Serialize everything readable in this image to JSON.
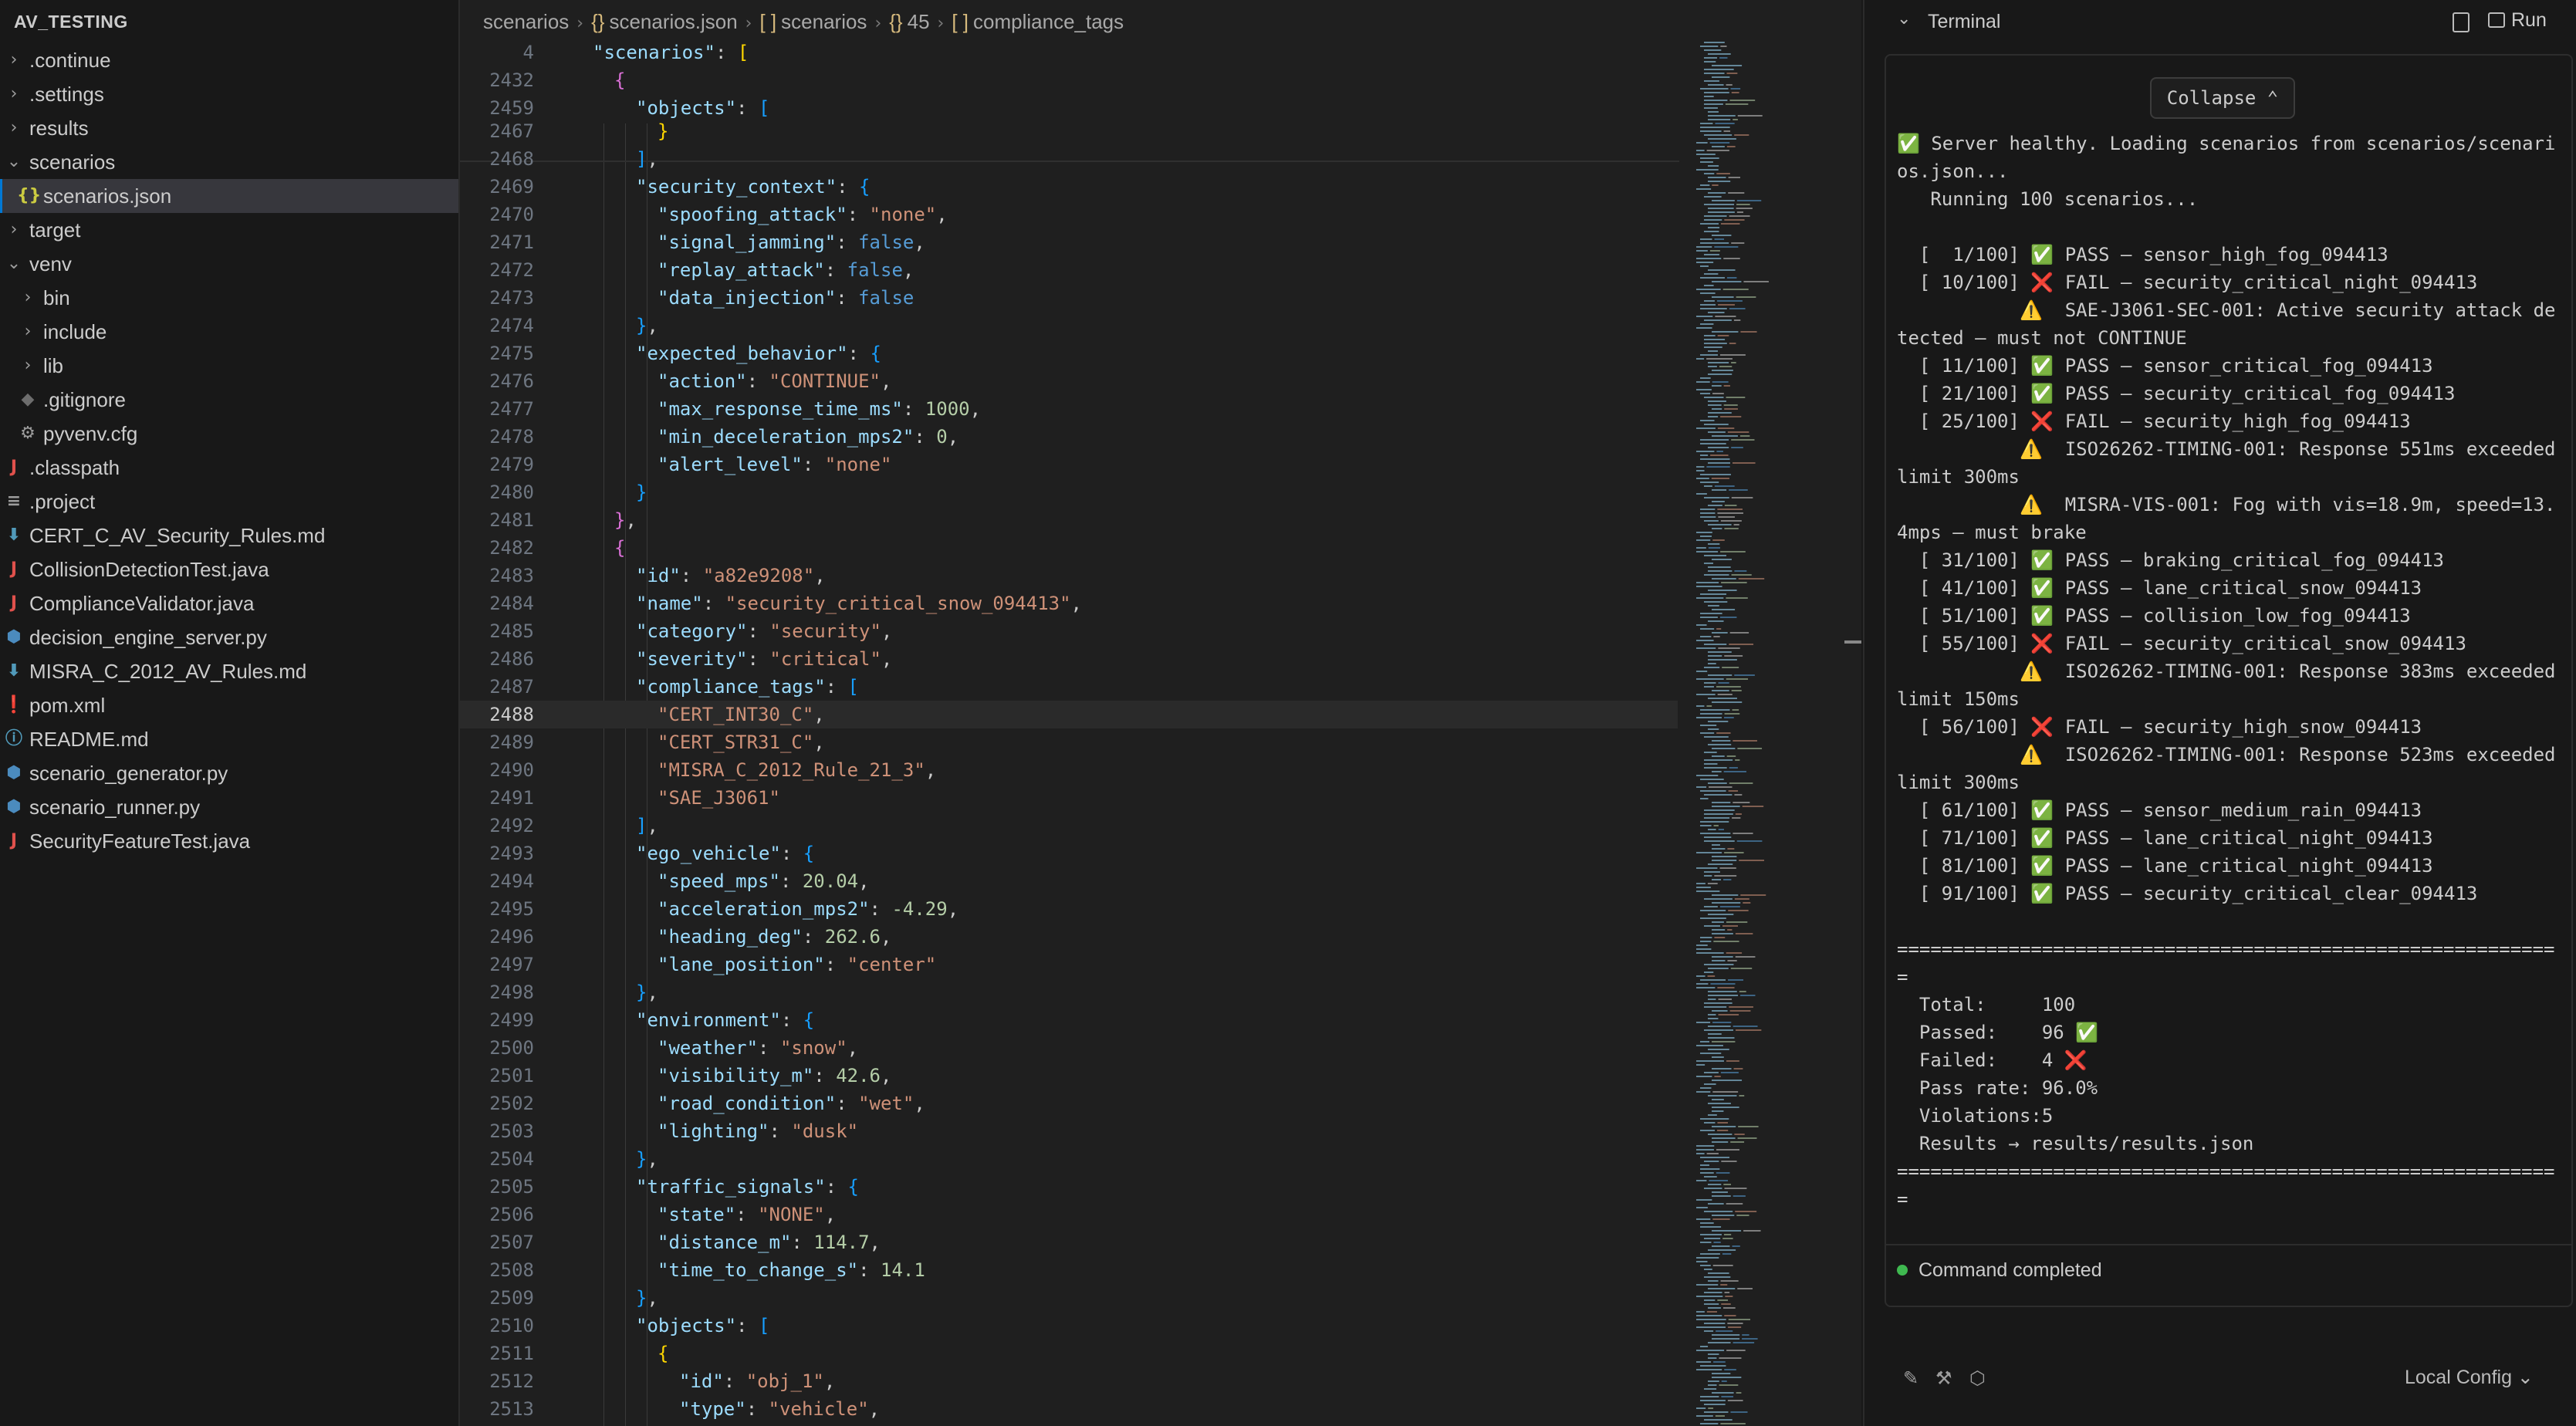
{
  "sidebar": {
    "title": "AV_TESTING",
    "items": [
      {
        "label": ".continue",
        "kind": "folder",
        "expanded": false,
        "depth": 0
      },
      {
        "label": ".settings",
        "kind": "folder",
        "expanded": false,
        "depth": 0
      },
      {
        "label": "results",
        "kind": "folder",
        "expanded": false,
        "depth": 0
      },
      {
        "label": "scenarios",
        "kind": "folder",
        "expanded": true,
        "depth": 0
      },
      {
        "label": "scenarios.json",
        "kind": "json",
        "depth": 1,
        "selected": true
      },
      {
        "label": "target",
        "kind": "folder",
        "expanded": false,
        "depth": 0
      },
      {
        "label": "venv",
        "kind": "folder",
        "expanded": true,
        "depth": 0
      },
      {
        "label": "bin",
        "kind": "folder",
        "expanded": false,
        "depth": 1
      },
      {
        "label": "include",
        "kind": "folder",
        "expanded": false,
        "depth": 1
      },
      {
        "label": "lib",
        "kind": "folder",
        "expanded": false,
        "depth": 1
      },
      {
        "label": ".gitignore",
        "kind": "gitignore",
        "depth": 1
      },
      {
        "label": "pyvenv.cfg",
        "kind": "gear",
        "depth": 1
      },
      {
        "label": ".classpath",
        "kind": "java",
        "depth": 0
      },
      {
        "label": ".project",
        "kind": "lines",
        "depth": 0
      },
      {
        "label": "CERT_C_AV_Security_Rules.md",
        "kind": "markdown",
        "depth": 0
      },
      {
        "label": "CollisionDetectionTest.java",
        "kind": "java",
        "depth": 0
      },
      {
        "label": "ComplianceValidator.java",
        "kind": "java",
        "depth": 0
      },
      {
        "label": "decision_engine_server.py",
        "kind": "python",
        "depth": 0
      },
      {
        "label": "MISRA_C_2012_AV_Rules.md",
        "kind": "markdown",
        "depth": 0
      },
      {
        "label": "pom.xml",
        "kind": "pom",
        "depth": 0
      },
      {
        "label": "README.md",
        "kind": "info",
        "depth": 0
      },
      {
        "label": "scenario_generator.py",
        "kind": "python",
        "depth": 0
      },
      {
        "label": "scenario_runner.py",
        "kind": "python",
        "depth": 0
      },
      {
        "label": "SecurityFeatureTest.java",
        "kind": "java",
        "depth": 0
      }
    ],
    "icon_colors": {
      "folder": "#9d9d9d",
      "json": "#cbcb41",
      "java": "#e0514c",
      "python": "#4b8bbe",
      "markdown": "#519aba",
      "gear": "#9d9d9d",
      "gitignore": "#6d6d6d",
      "lines": "#9d9d9d",
      "pom": "#e0514c",
      "info": "#519aba"
    }
  },
  "breadcrumb": [
    {
      "label": "scenarios",
      "icon": ""
    },
    {
      "label": "scenarios.json",
      "icon": "{}"
    },
    {
      "label": "scenarios",
      "icon": "[ ]"
    },
    {
      "label": "45",
      "icon": "{}"
    },
    {
      "label": "compliance_tags",
      "icon": "[ ]"
    }
  ],
  "editor": {
    "sticky_lines": [
      {
        "n": "4",
        "ind": 1,
        "t": [
          [
            "k",
            "\"scenarios\""
          ],
          [
            "p",
            ": "
          ],
          [
            "br1",
            "["
          ]
        ]
      },
      {
        "n": "2432",
        "ind": 2,
        "t": [
          [
            "br2",
            "{"
          ]
        ]
      },
      {
        "n": "2459",
        "ind": 3,
        "t": [
          [
            "k",
            "\"objects\""
          ],
          [
            "p",
            ": "
          ],
          [
            "br3",
            "["
          ]
        ]
      }
    ],
    "current_line": "2488",
    "lines": [
      {
        "n": "2467",
        "ind": 4,
        "t": [
          [
            "br1",
            "}"
          ]
        ]
      },
      {
        "n": "2468",
        "ind": 3,
        "t": [
          [
            "br3",
            "]"
          ],
          [
            "p",
            ","
          ]
        ]
      },
      {
        "n": "2469",
        "ind": 3,
        "t": [
          [
            "k",
            "\"security_context\""
          ],
          [
            "p",
            ": "
          ],
          [
            "br3",
            "{"
          ]
        ]
      },
      {
        "n": "2470",
        "ind": 4,
        "t": [
          [
            "k",
            "\"spoofing_attack\""
          ],
          [
            "p",
            ": "
          ],
          [
            "s",
            "\"none\""
          ],
          [
            "p",
            ","
          ]
        ]
      },
      {
        "n": "2471",
        "ind": 4,
        "t": [
          [
            "k",
            "\"signal_jamming\""
          ],
          [
            "p",
            ": "
          ],
          [
            "b",
            "false"
          ],
          [
            "p",
            ","
          ]
        ]
      },
      {
        "n": "2472",
        "ind": 4,
        "t": [
          [
            "k",
            "\"replay_attack\""
          ],
          [
            "p",
            ": "
          ],
          [
            "b",
            "false"
          ],
          [
            "p",
            ","
          ]
        ]
      },
      {
        "n": "2473",
        "ind": 4,
        "t": [
          [
            "k",
            "\"data_injection\""
          ],
          [
            "p",
            ": "
          ],
          [
            "b",
            "false"
          ]
        ]
      },
      {
        "n": "2474",
        "ind": 3,
        "t": [
          [
            "br3",
            "}"
          ],
          [
            "p",
            ","
          ]
        ]
      },
      {
        "n": "2475",
        "ind": 3,
        "t": [
          [
            "k",
            "\"expected_behavior\""
          ],
          [
            "p",
            ": "
          ],
          [
            "br3",
            "{"
          ]
        ]
      },
      {
        "n": "2476",
        "ind": 4,
        "t": [
          [
            "k",
            "\"action\""
          ],
          [
            "p",
            ": "
          ],
          [
            "s",
            "\"CONTINUE\""
          ],
          [
            "p",
            ","
          ]
        ]
      },
      {
        "n": "2477",
        "ind": 4,
        "t": [
          [
            "k",
            "\"max_response_time_ms\""
          ],
          [
            "p",
            ": "
          ],
          [
            "n",
            "1000"
          ],
          [
            "p",
            ","
          ]
        ]
      },
      {
        "n": "2478",
        "ind": 4,
        "t": [
          [
            "k",
            "\"min_deceleration_mps2\""
          ],
          [
            "p",
            ": "
          ],
          [
            "n",
            "0"
          ],
          [
            "p",
            ","
          ]
        ]
      },
      {
        "n": "2479",
        "ind": 4,
        "t": [
          [
            "k",
            "\"alert_level\""
          ],
          [
            "p",
            ": "
          ],
          [
            "s",
            "\"none\""
          ]
        ]
      },
      {
        "n": "2480",
        "ind": 3,
        "t": [
          [
            "br3",
            "}"
          ]
        ]
      },
      {
        "n": "2481",
        "ind": 2,
        "t": [
          [
            "br2",
            "}"
          ],
          [
            "p",
            ","
          ]
        ]
      },
      {
        "n": "2482",
        "ind": 2,
        "t": [
          [
            "br2",
            "{"
          ]
        ]
      },
      {
        "n": "2483",
        "ind": 3,
        "t": [
          [
            "k",
            "\"id\""
          ],
          [
            "p",
            ": "
          ],
          [
            "s",
            "\"a82e9208\""
          ],
          [
            "p",
            ","
          ]
        ]
      },
      {
        "n": "2484",
        "ind": 3,
        "t": [
          [
            "k",
            "\"name\""
          ],
          [
            "p",
            ": "
          ],
          [
            "s",
            "\"security_critical_snow_094413\""
          ],
          [
            "p",
            ","
          ]
        ]
      },
      {
        "n": "2485",
        "ind": 3,
        "t": [
          [
            "k",
            "\"category\""
          ],
          [
            "p",
            ": "
          ],
          [
            "s",
            "\"security\""
          ],
          [
            "p",
            ","
          ]
        ]
      },
      {
        "n": "2486",
        "ind": 3,
        "t": [
          [
            "k",
            "\"severity\""
          ],
          [
            "p",
            ": "
          ],
          [
            "s",
            "\"critical\""
          ],
          [
            "p",
            ","
          ]
        ]
      },
      {
        "n": "2487",
        "ind": 3,
        "t": [
          [
            "k",
            "\"compliance_tags\""
          ],
          [
            "p",
            ": "
          ],
          [
            "br3",
            "["
          ]
        ]
      },
      {
        "n": "2488",
        "ind": 4,
        "t": [
          [
            "s",
            "\"CERT_INT30_C\""
          ],
          [
            "p",
            ","
          ]
        ]
      },
      {
        "n": "2489",
        "ind": 4,
        "t": [
          [
            "s",
            "\"CERT_STR31_C\""
          ],
          [
            "p",
            ","
          ]
        ]
      },
      {
        "n": "2490",
        "ind": 4,
        "t": [
          [
            "s",
            "\"MISRA_C_2012_Rule_21_3\""
          ],
          [
            "p",
            ","
          ]
        ]
      },
      {
        "n": "2491",
        "ind": 4,
        "t": [
          [
            "s",
            "\"SAE_J3061\""
          ]
        ]
      },
      {
        "n": "2492",
        "ind": 3,
        "t": [
          [
            "br3",
            "]"
          ],
          [
            "p",
            ","
          ]
        ]
      },
      {
        "n": "2493",
        "ind": 3,
        "t": [
          [
            "k",
            "\"ego_vehicle\""
          ],
          [
            "p",
            ": "
          ],
          [
            "br3",
            "{"
          ]
        ]
      },
      {
        "n": "2494",
        "ind": 4,
        "t": [
          [
            "k",
            "\"speed_mps\""
          ],
          [
            "p",
            ": "
          ],
          [
            "n",
            "20.04"
          ],
          [
            "p",
            ","
          ]
        ]
      },
      {
        "n": "2495",
        "ind": 4,
        "t": [
          [
            "k",
            "\"acceleration_mps2\""
          ],
          [
            "p",
            ": "
          ],
          [
            "n",
            "-4.29"
          ],
          [
            "p",
            ","
          ]
        ]
      },
      {
        "n": "2496",
        "ind": 4,
        "t": [
          [
            "k",
            "\"heading_deg\""
          ],
          [
            "p",
            ": "
          ],
          [
            "n",
            "262.6"
          ],
          [
            "p",
            ","
          ]
        ]
      },
      {
        "n": "2497",
        "ind": 4,
        "t": [
          [
            "k",
            "\"lane_position\""
          ],
          [
            "p",
            ": "
          ],
          [
            "s",
            "\"center\""
          ]
        ]
      },
      {
        "n": "2498",
        "ind": 3,
        "t": [
          [
            "br3",
            "}"
          ],
          [
            "p",
            ","
          ]
        ]
      },
      {
        "n": "2499",
        "ind": 3,
        "t": [
          [
            "k",
            "\"environment\""
          ],
          [
            "p",
            ": "
          ],
          [
            "br3",
            "{"
          ]
        ]
      },
      {
        "n": "2500",
        "ind": 4,
        "t": [
          [
            "k",
            "\"weather\""
          ],
          [
            "p",
            ": "
          ],
          [
            "s",
            "\"snow\""
          ],
          [
            "p",
            ","
          ]
        ]
      },
      {
        "n": "2501",
        "ind": 4,
        "t": [
          [
            "k",
            "\"visibility_m\""
          ],
          [
            "p",
            ": "
          ],
          [
            "n",
            "42.6"
          ],
          [
            "p",
            ","
          ]
        ]
      },
      {
        "n": "2502",
        "ind": 4,
        "t": [
          [
            "k",
            "\"road_condition\""
          ],
          [
            "p",
            ": "
          ],
          [
            "s",
            "\"wet\""
          ],
          [
            "p",
            ","
          ]
        ]
      },
      {
        "n": "2503",
        "ind": 4,
        "t": [
          [
            "k",
            "\"lighting\""
          ],
          [
            "p",
            ": "
          ],
          [
            "s",
            "\"dusk\""
          ]
        ]
      },
      {
        "n": "2504",
        "ind": 3,
        "t": [
          [
            "br3",
            "}"
          ],
          [
            "p",
            ","
          ]
        ]
      },
      {
        "n": "2505",
        "ind": 3,
        "t": [
          [
            "k",
            "\"traffic_signals\""
          ],
          [
            "p",
            ": "
          ],
          [
            "br3",
            "{"
          ]
        ]
      },
      {
        "n": "2506",
        "ind": 4,
        "t": [
          [
            "k",
            "\"state\""
          ],
          [
            "p",
            ": "
          ],
          [
            "s",
            "\"NONE\""
          ],
          [
            "p",
            ","
          ]
        ]
      },
      {
        "n": "2507",
        "ind": 4,
        "t": [
          [
            "k",
            "\"distance_m\""
          ],
          [
            "p",
            ": "
          ],
          [
            "n",
            "114.7"
          ],
          [
            "p",
            ","
          ]
        ]
      },
      {
        "n": "2508",
        "ind": 4,
        "t": [
          [
            "k",
            "\"time_to_change_s\""
          ],
          [
            "p",
            ": "
          ],
          [
            "n",
            "14.1"
          ]
        ]
      },
      {
        "n": "2509",
        "ind": 3,
        "t": [
          [
            "br3",
            "}"
          ],
          [
            "p",
            ","
          ]
        ]
      },
      {
        "n": "2510",
        "ind": 3,
        "t": [
          [
            "k",
            "\"objects\""
          ],
          [
            "p",
            ": "
          ],
          [
            "br3",
            "["
          ]
        ]
      },
      {
        "n": "2511",
        "ind": 4,
        "t": [
          [
            "br1",
            "{"
          ]
        ]
      },
      {
        "n": "2512",
        "ind": 5,
        "t": [
          [
            "k",
            "\"id\""
          ],
          [
            "p",
            ": "
          ],
          [
            "s",
            "\"obj_1\""
          ],
          [
            "p",
            ","
          ]
        ]
      },
      {
        "n": "2513",
        "ind": 5,
        "t": [
          [
            "k",
            "\"type\""
          ],
          [
            "p",
            ": "
          ],
          [
            "s",
            "\"vehicle\""
          ],
          [
            "p",
            ","
          ]
        ]
      }
    ]
  },
  "terminal": {
    "title": "Terminal",
    "run_label": "Run",
    "collapse_label": "Collapse ⌃",
    "output_lines": [
      {
        "c": "ok",
        "t": "✅ Server healthy. Loading scenarios from scenarios/scenarios.json..."
      },
      {
        "c": "",
        "t": "   Running 100 scenarios..."
      },
      {
        "c": "",
        "t": " "
      },
      {
        "c": "",
        "t": "  [  1/100] ✅ PASS — sensor_high_fog_094413"
      },
      {
        "c": "",
        "t": "  [ 10/100] ❌ FAIL — security_critical_night_094413"
      },
      {
        "c": "",
        "t": "           ⚠️  SAE-J3061-SEC-001: Active security attack detected — must not CONTINUE"
      },
      {
        "c": "",
        "t": "  [ 11/100] ✅ PASS — sensor_critical_fog_094413"
      },
      {
        "c": "",
        "t": "  [ 21/100] ✅ PASS — security_critical_fog_094413"
      },
      {
        "c": "",
        "t": "  [ 25/100] ❌ FAIL — security_high_fog_094413"
      },
      {
        "c": "",
        "t": "           ⚠️  ISO26262-TIMING-001: Response 551ms exceeded limit 300ms"
      },
      {
        "c": "",
        "t": "           ⚠️  MISRA-VIS-001: Fog with vis=18.9m, speed=13.4mps — must brake"
      },
      {
        "c": "",
        "t": "  [ 31/100] ✅ PASS — braking_critical_fog_094413"
      },
      {
        "c": "",
        "t": "  [ 41/100] ✅ PASS — lane_critical_snow_094413"
      },
      {
        "c": "",
        "t": "  [ 51/100] ✅ PASS — collision_low_fog_094413"
      },
      {
        "c": "",
        "t": "  [ 55/100] ❌ FAIL — security_critical_snow_094413"
      },
      {
        "c": "",
        "t": "           ⚠️  ISO26262-TIMING-001: Response 383ms exceeded limit 150ms"
      },
      {
        "c": "",
        "t": "  [ 56/100] ❌ FAIL — security_high_snow_094413"
      },
      {
        "c": "",
        "t": "           ⚠️  ISO26262-TIMING-001: Response 523ms exceeded limit 300ms"
      },
      {
        "c": "",
        "t": "  [ 61/100] ✅ PASS — sensor_medium_rain_094413"
      },
      {
        "c": "",
        "t": "  [ 71/100] ✅ PASS — lane_critical_night_094413"
      },
      {
        "c": "",
        "t": "  [ 81/100] ✅ PASS — lane_critical_night_094413"
      },
      {
        "c": "",
        "t": "  [ 91/100] ✅ PASS — security_critical_clear_094413"
      },
      {
        "c": "",
        "t": " "
      },
      {
        "c": "",
        "t": "============================================================"
      },
      {
        "c": "",
        "t": "  Total:     100"
      },
      {
        "c": "",
        "t": "  Passed:    96 ✅"
      },
      {
        "c": "",
        "t": "  Failed:    4 ❌"
      },
      {
        "c": "",
        "t": "  Pass rate: 96.0%"
      },
      {
        "c": "",
        "t": "  Violations:5"
      },
      {
        "c": "",
        "t": "  Results → results/results.json"
      },
      {
        "c": "",
        "t": "============================================================"
      }
    ],
    "status": "Command completed"
  },
  "footer": {
    "config_label": "Local Config ⌄"
  }
}
